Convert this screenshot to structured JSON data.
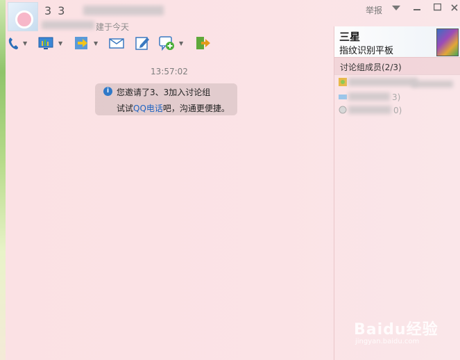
{
  "window": {
    "title": "3  3",
    "subtitle": "建于今天",
    "report": "举报"
  },
  "toolbar": {
    "icons": [
      "phone-icon",
      "screen-share-icon",
      "file-transfer-icon",
      "email-icon",
      "note-icon",
      "add-app-icon",
      "exit-icon"
    ]
  },
  "chat": {
    "timestamp": "13:57:02",
    "system_message": {
      "line1": "您邀请了3、3加入讨论组",
      "line2_prefix": "试试",
      "line2_link": "QQ电话",
      "line2_suffix": "吧，沟通更便捷。"
    }
  },
  "ad": {
    "title": "三星",
    "subtitle": "指纹识别平板"
  },
  "members": {
    "header": "讨论组成员(2/3)",
    "items": [
      {
        "text": ""
      },
      {
        "text": "3)"
      },
      {
        "text": "0)"
      }
    ]
  },
  "watermark": {
    "logo": "Baidu经验",
    "url": "jingyan.baidu.com"
  },
  "colors": {
    "background": "#fbe4e6",
    "link": "#1e63c1",
    "info_icon": "#2f79c8"
  }
}
